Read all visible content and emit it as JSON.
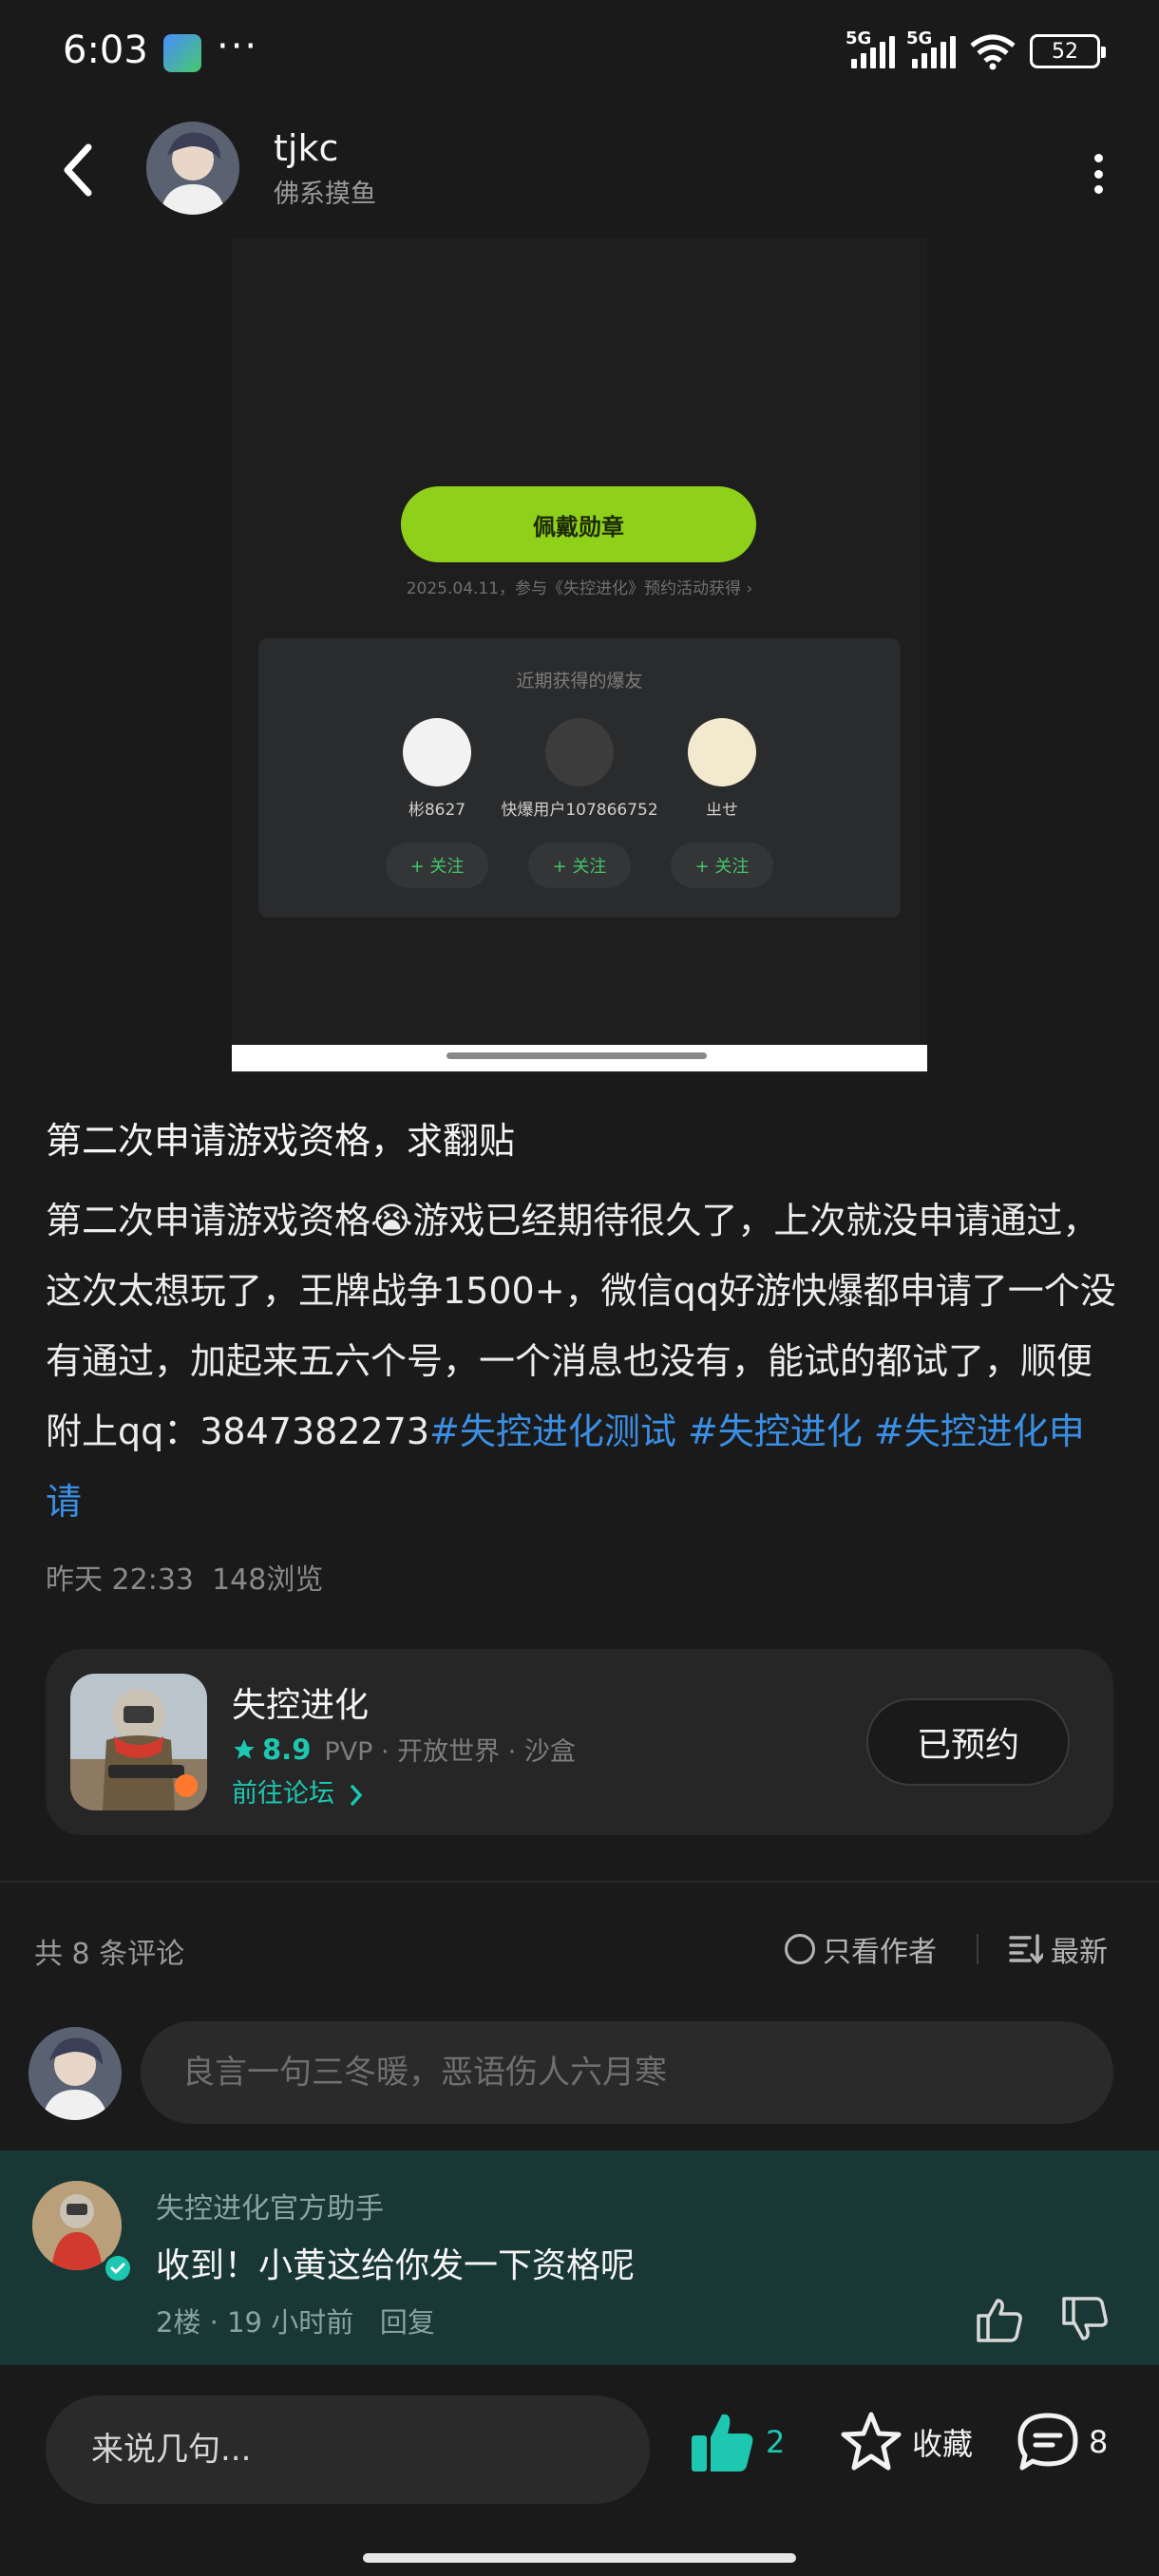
{
  "status_bar": {
    "time": "6:03",
    "more": "···",
    "net1": "5G",
    "net2": "5G",
    "battery": "52"
  },
  "header": {
    "author_name": "tjkc",
    "author_subtitle": "佛系摸鱼",
    "back_icon": "chevron-left-icon",
    "menu_icon": "more-vertical-icon"
  },
  "embedded_image": {
    "button_label": "佩戴勋章",
    "subtitle": "2025.04.11，参与《失控进化》预约活动获得 ›",
    "card_title": "近期获得的爆友",
    "users": [
      {
        "name": "彬8627",
        "follow": "+ 关注"
      },
      {
        "name": "快爆用户107866752",
        "follow": "+ 关注"
      },
      {
        "name": "ㄓせ",
        "follow": "+ 关注"
      }
    ]
  },
  "post": {
    "title": "第二次申请游戏资格，求翻贴",
    "body_text": "第二次申请游戏资格😭游戏已经期待很久了，上次就没申请通过，这次太想玩了，王牌战争1500+，微信qq好游快爆都申请了一个没有通过，加起来五六个号，一个消息也没有，能试的都试了，顺便附上qq：3847382273",
    "tags": [
      "#失控进化测试",
      "#失控进化",
      "#失控进化申请"
    ],
    "time": "昨天 22:33",
    "views": "148浏览"
  },
  "game_card": {
    "name": "失控进化",
    "score": "8.9",
    "genres": "PVP · 开放世界 · 沙盒",
    "forum_link": "前往论坛",
    "reserve_label": "已预约"
  },
  "comments_header": {
    "count_label": "共 8 条评论",
    "only_author": "只看作者",
    "sort_label": "最新"
  },
  "comment_input": {
    "placeholder": "良言一句三冬暖，恶语伤人六月寒"
  },
  "comments": [
    {
      "name": "失控进化官方助手",
      "text": "收到！小黄这给你发一下资格呢",
      "meta": "2楼 · 19 小时前",
      "reply": "回复"
    }
  ],
  "bottom_bar": {
    "placeholder": "来说几句...",
    "likes": "2",
    "favorite_label": "收藏",
    "comments": "8"
  },
  "colors": {
    "accent": "#1ec7b0",
    "link": "#3b8fe3",
    "badge_green": "#8fd11a",
    "highlight_bg": "#183735"
  }
}
